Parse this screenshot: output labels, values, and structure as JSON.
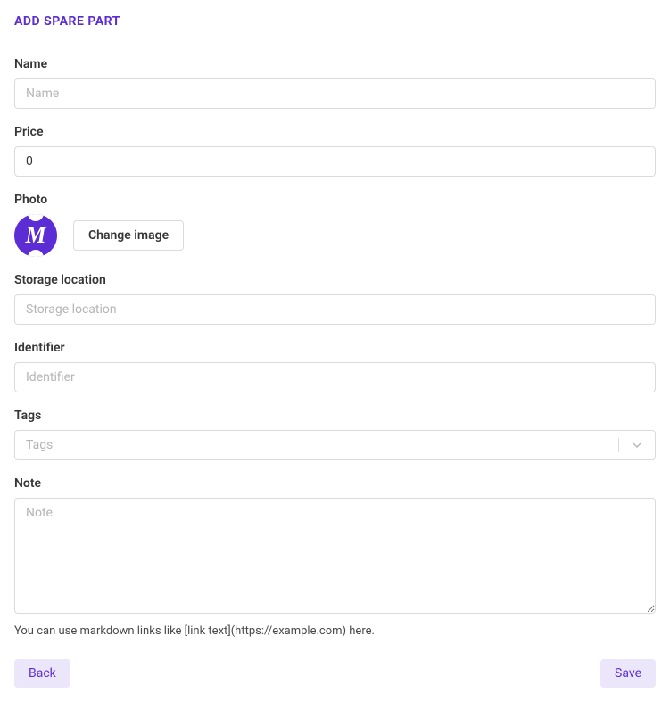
{
  "page": {
    "title": "ADD SPARE PART"
  },
  "form": {
    "name": {
      "label": "Name",
      "placeholder": "Name",
      "value": ""
    },
    "price": {
      "label": "Price",
      "value": "0"
    },
    "photo": {
      "label": "Photo",
      "avatar_letter": "M",
      "change_button": "Change image"
    },
    "storage_location": {
      "label": "Storage location",
      "placeholder": "Storage location",
      "value": ""
    },
    "identifier": {
      "label": "Identifier",
      "placeholder": "Identifier",
      "value": ""
    },
    "tags": {
      "label": "Tags",
      "placeholder": "Tags"
    },
    "note": {
      "label": "Note",
      "placeholder": "Note",
      "value": "",
      "help": "You can use markdown links like [link text](https://example.com) here."
    }
  },
  "buttons": {
    "back": "Back",
    "save": "Save"
  }
}
